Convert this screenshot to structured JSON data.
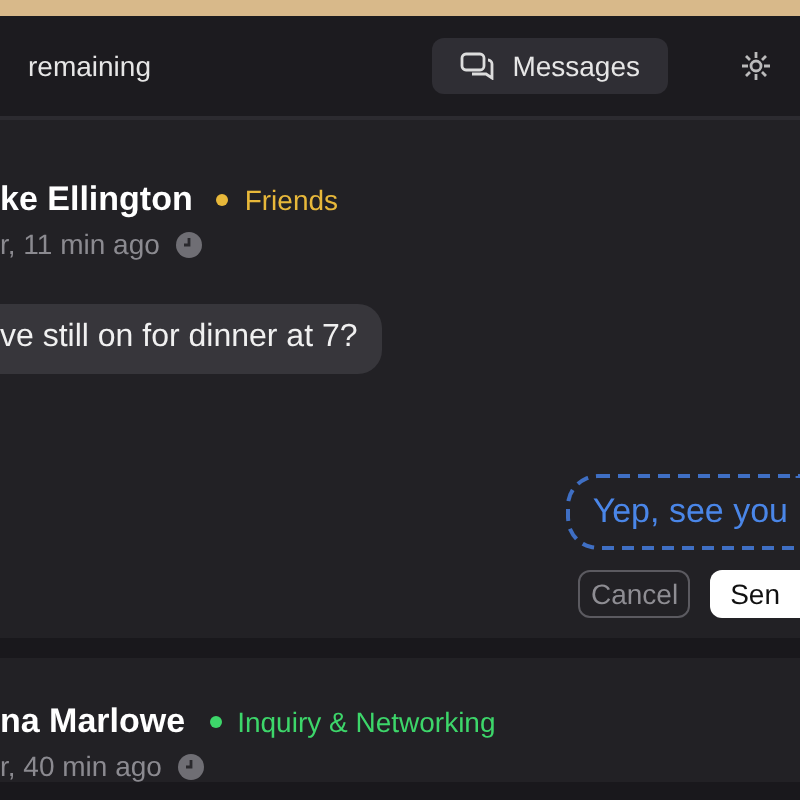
{
  "header": {
    "remaining": "remaining",
    "tabs": [
      {
        "label": "Messages",
        "selected": true
      },
      {
        "selected": false
      }
    ]
  },
  "threads": [
    {
      "name": "ke Ellington",
      "tag": "Friends",
      "color": "#e8b83a",
      "time": "r, 11 min ago",
      "incoming": "ve still on for dinner at 7?",
      "draft": "Yep, see you",
      "actions": [
        "Cancel",
        "Sen"
      ]
    },
    {
      "name": "na Marlowe",
      "tag": "Inquiry & Networking",
      "color": "#3dd66a",
      "time": "r, 40 min ago"
    }
  ]
}
